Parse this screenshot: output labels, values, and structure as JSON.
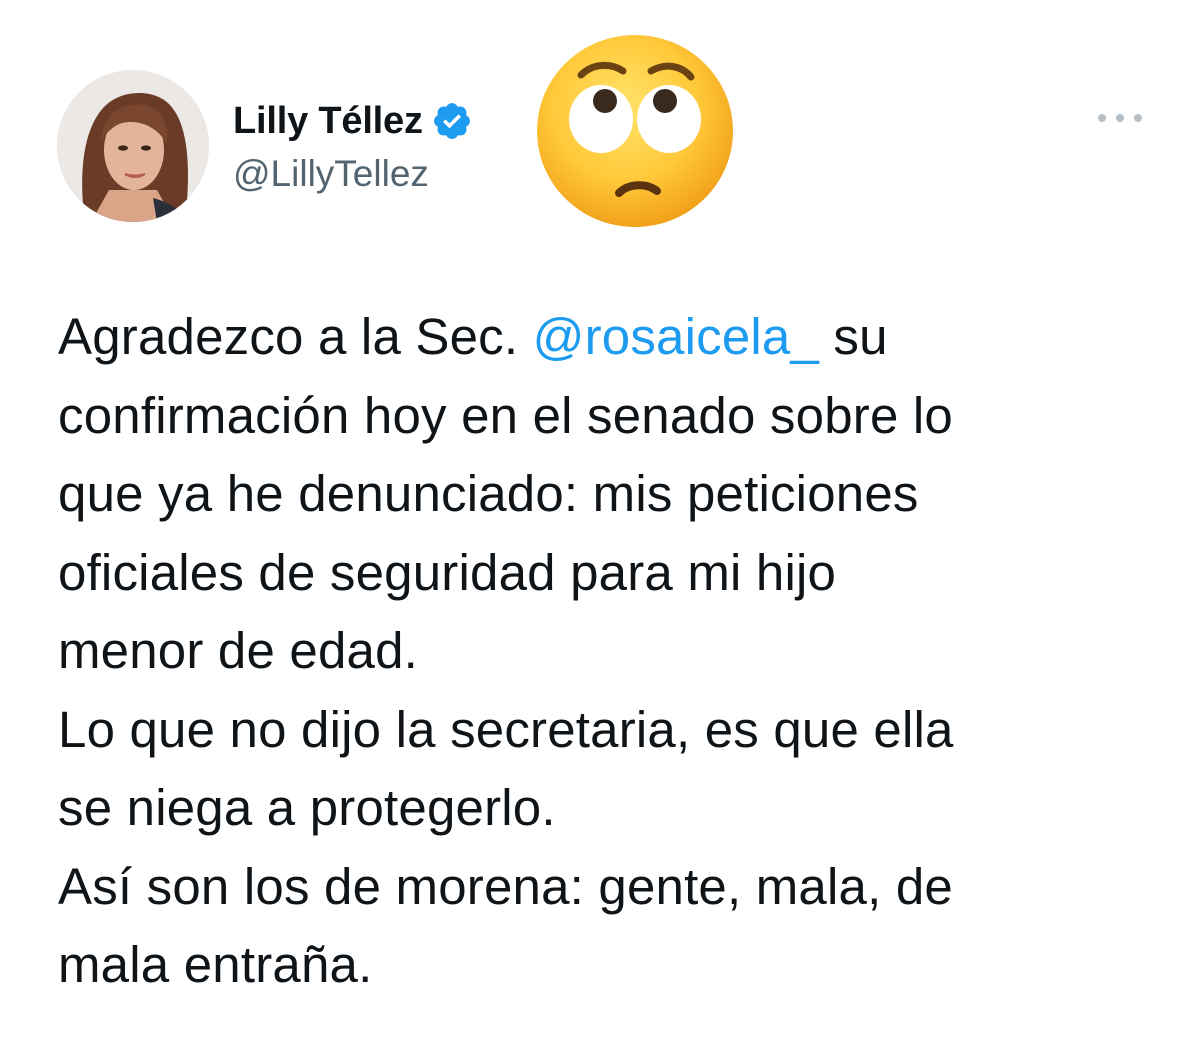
{
  "author": {
    "display_name": "Lilly Téllez",
    "handle": "@LillyTellez",
    "verified_icon": "verified-badge-icon",
    "verified_color": "#1d9bf0"
  },
  "reaction_emoji": "face-with-rolling-eyes-icon",
  "more_menu_icon": "more-options-icon",
  "tweet": {
    "line1_a": "Agradezco a la Sec. ",
    "mention": "@rosaicela_",
    "line1_b": " su",
    "line2": "confirmación hoy en el senado sobre lo",
    "line3": "que ya he denunciado: mis peticiones",
    "line4": "oficiales de seguridad para mi hijo",
    "line5": "menor de edad.",
    "line6": "Lo que no dijo la secretaria, es que ella",
    "line7": "se niega a protegerlo.",
    "line8": "Así son los de morena: gente, mala, de",
    "line9": "mala entraña."
  },
  "colors": {
    "text": "#0f1419",
    "secondary": "#536471",
    "link": "#1d9bf0"
  }
}
